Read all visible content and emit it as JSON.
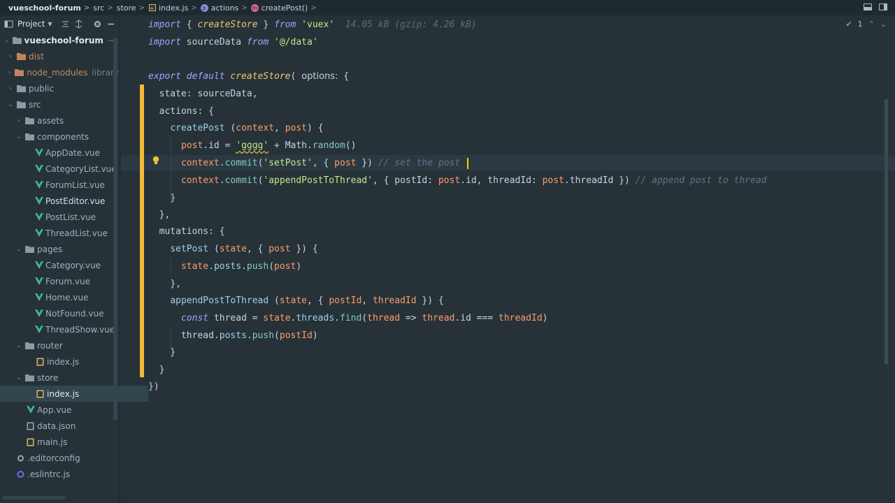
{
  "breadcrumb": {
    "project": "vueschool-forum",
    "items": [
      "src",
      "store",
      "index.js",
      "actions",
      "createPost()"
    ]
  },
  "sidebar": {
    "title": "Project",
    "root_name": "vueschool-forum",
    "root_path": "~/co",
    "tree": [
      {
        "label": "dist",
        "kind": "folder"
      },
      {
        "label": "node_modules",
        "kind": "folder",
        "extra": "library"
      },
      {
        "label": "public",
        "kind": "folder"
      },
      {
        "label": "src",
        "kind": "folder"
      },
      {
        "label": "assets",
        "kind": "folder"
      },
      {
        "label": "components",
        "kind": "folder"
      },
      {
        "label": "AppDate.vue",
        "kind": "vue"
      },
      {
        "label": "CategoryList.vue",
        "kind": "vue"
      },
      {
        "label": "ForumList.vue",
        "kind": "vue"
      },
      {
        "label": "PostEditor.vue",
        "kind": "vue"
      },
      {
        "label": "PostList.vue",
        "kind": "vue"
      },
      {
        "label": "ThreadList.vue",
        "kind": "vue"
      },
      {
        "label": "pages",
        "kind": "folder"
      },
      {
        "label": "Category.vue",
        "kind": "vue"
      },
      {
        "label": "Forum.vue",
        "kind": "vue"
      },
      {
        "label": "Home.vue",
        "kind": "vue"
      },
      {
        "label": "NotFound.vue",
        "kind": "vue"
      },
      {
        "label": "ThreadShow.vue",
        "kind": "vue"
      },
      {
        "label": "router",
        "kind": "folder"
      },
      {
        "label": "index.js",
        "kind": "js"
      },
      {
        "label": "store",
        "kind": "folder"
      },
      {
        "label": "index.js",
        "kind": "js",
        "selected": true
      },
      {
        "label": "App.vue",
        "kind": "vue"
      },
      {
        "label": "data.json",
        "kind": "json"
      },
      {
        "label": "main.js",
        "kind": "js"
      },
      {
        "label": ".editorconfig",
        "kind": "config"
      },
      {
        "label": ".eslintrc.js",
        "kind": "eslint"
      }
    ]
  },
  "editor": {
    "problems_count": "1",
    "import_size_hint": "14.05 kB (gzip: 4.26 kB)",
    "param_hint": "options:",
    "comment_set_post": "// set the post",
    "comment_append": "// append post to thread",
    "import_vuex": "'vuex'",
    "import_data": "'@/data'",
    "str_gggg": "'gggg'",
    "str_setpost": "'setPost'",
    "str_append": "'appendPostToThread'"
  }
}
